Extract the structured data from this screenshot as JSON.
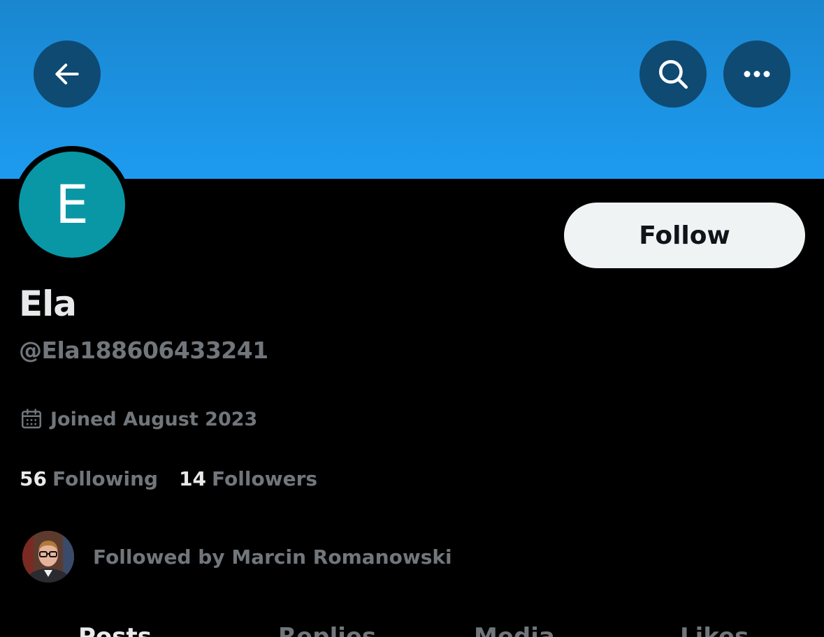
{
  "colors": {
    "banner": "#1d9bf0",
    "avatar_bg": "#0997a6",
    "follow_bg": "#eff3f4",
    "secondary_text": "#71767b",
    "primary_text": "#e7e9ea"
  },
  "header": {
    "back_icon": "arrow-left-icon",
    "search_icon": "search-icon",
    "more_icon": "more-horizontal-icon"
  },
  "profile": {
    "avatar_letter": "E",
    "display_name": "Ela",
    "handle": "@Ela188606433241",
    "follow_label": "Follow",
    "joined": "Joined August 2023",
    "following_count": "56",
    "following_label": "Following",
    "followers_count": "14",
    "followers_label": "Followers",
    "followed_by": "Followed by Marcin Romanowski"
  },
  "tabs": [
    {
      "label": "Posts"
    },
    {
      "label": "Replies"
    },
    {
      "label": "Media"
    },
    {
      "label": "Likes"
    }
  ]
}
